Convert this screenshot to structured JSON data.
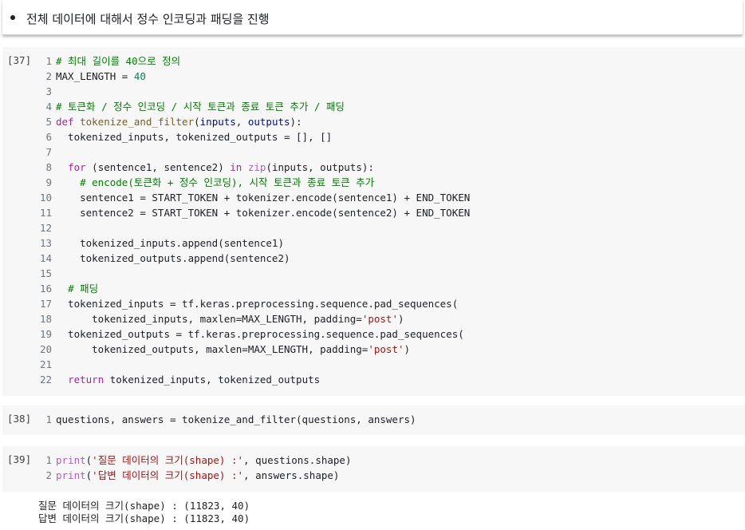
{
  "text_cell": {
    "bullet": "전체 데이터에 대해서 정수 인코딩과 패딩을 진행"
  },
  "cells": [
    {
      "exec_count": "[37]",
      "lines": [
        {
          "n": "1",
          "tokens": [
            [
              "cm",
              "# 최대 길이를 40으로 정의"
            ]
          ]
        },
        {
          "n": "2",
          "tokens": [
            [
              "tx",
              "MAX_LENGTH = "
            ],
            [
              "num",
              "40"
            ]
          ]
        },
        {
          "n": "3",
          "tokens": []
        },
        {
          "n": "4",
          "tokens": [
            [
              "cm",
              "# 토큰화 / 정수 인코딩 / 시작 토큰과 종료 토큰 추가 / 패딩"
            ]
          ]
        },
        {
          "n": "5",
          "tokens": [
            [
              "kw",
              "def "
            ],
            [
              "fn",
              "tokenize_and_filter"
            ],
            [
              "tx",
              "("
            ],
            [
              "var",
              "inputs"
            ],
            [
              "tx",
              ", "
            ],
            [
              "var",
              "outputs"
            ],
            [
              "tx",
              "):"
            ]
          ]
        },
        {
          "n": "6",
          "tokens": [
            [
              "tx",
              "  tokenized_inputs, tokenized_outputs = [], []"
            ]
          ]
        },
        {
          "n": "7",
          "tokens": []
        },
        {
          "n": "8",
          "tokens": [
            [
              "tx",
              "  "
            ],
            [
              "kw",
              "for"
            ],
            [
              "tx",
              " (sentence1, sentence2) "
            ],
            [
              "kw",
              "in"
            ],
            [
              "tx",
              " "
            ],
            [
              "bi",
              "zip"
            ],
            [
              "tx",
              "(inputs, outputs):"
            ]
          ]
        },
        {
          "n": "9",
          "tokens": [
            [
              "tx",
              "    "
            ],
            [
              "cm",
              "# encode(토큰화 + 정수 인코딩), 시작 토큰과 종료 토큰 추가"
            ]
          ]
        },
        {
          "n": "10",
          "tokens": [
            [
              "tx",
              "    sentence1 = START_TOKEN + tokenizer.encode(sentence1) + END_TOKEN"
            ]
          ]
        },
        {
          "n": "11",
          "tokens": [
            [
              "tx",
              "    sentence2 = START_TOKEN + tokenizer.encode(sentence2) + END_TOKEN"
            ]
          ]
        },
        {
          "n": "12",
          "tokens": []
        },
        {
          "n": "13",
          "tokens": [
            [
              "tx",
              "    tokenized_inputs.append(sentence1)"
            ]
          ]
        },
        {
          "n": "14",
          "tokens": [
            [
              "tx",
              "    tokenized_outputs.append(sentence2)"
            ]
          ]
        },
        {
          "n": "15",
          "tokens": []
        },
        {
          "n": "16",
          "tokens": [
            [
              "tx",
              "  "
            ],
            [
              "cm",
              "# 패딩"
            ]
          ]
        },
        {
          "n": "17",
          "tokens": [
            [
              "tx",
              "  tokenized_inputs = tf.keras.preprocessing.sequence.pad_sequences("
            ]
          ]
        },
        {
          "n": "18",
          "tokens": [
            [
              "tx",
              "      tokenized_inputs, maxlen=MAX_LENGTH, padding="
            ],
            [
              "str",
              "'post'"
            ],
            [
              "tx",
              ")"
            ]
          ]
        },
        {
          "n": "19",
          "tokens": [
            [
              "tx",
              "  tokenized_outputs = tf.keras.preprocessing.sequence.pad_sequences("
            ]
          ]
        },
        {
          "n": "20",
          "tokens": [
            [
              "tx",
              "      tokenized_outputs, maxlen=MAX_LENGTH, padding="
            ],
            [
              "str",
              "'post'"
            ],
            [
              "tx",
              ")"
            ]
          ]
        },
        {
          "n": "21",
          "tokens": []
        },
        {
          "n": "22",
          "tokens": [
            [
              "tx",
              "  "
            ],
            [
              "kw",
              "return"
            ],
            [
              "tx",
              " tokenized_inputs, tokenized_outputs"
            ]
          ]
        }
      ]
    },
    {
      "exec_count": "[38]",
      "lines": [
        {
          "n": "1",
          "tokens": [
            [
              "tx",
              "questions, answers = tokenize_and_filter(questions, answers)"
            ]
          ]
        }
      ]
    },
    {
      "exec_count": "[39]",
      "lines": [
        {
          "n": "1",
          "tokens": [
            [
              "bi",
              "print"
            ],
            [
              "tx",
              "("
            ],
            [
              "str",
              "'질문 데이터의 크기(shape) :'"
            ],
            [
              "tx",
              ", questions.shape)"
            ]
          ]
        },
        {
          "n": "2",
          "tokens": [
            [
              "bi",
              "print"
            ],
            [
              "tx",
              "("
            ],
            [
              "str",
              "'답변 데이터의 크기(shape) :'"
            ],
            [
              "tx",
              ", answers.shape)"
            ]
          ]
        }
      ]
    }
  ],
  "output": {
    "lines": [
      "질문 데이터의 크기(shape) : (11823, 40)",
      "답변 데이터의 크기(shape) : (11823, 40)"
    ]
  }
}
